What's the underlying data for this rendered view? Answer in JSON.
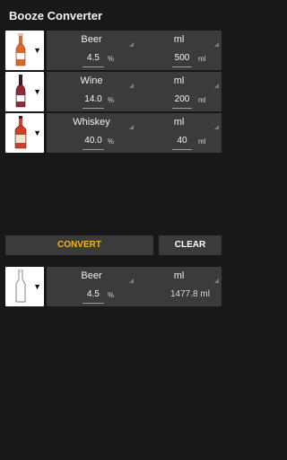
{
  "app": {
    "title": "Booze Converter"
  },
  "rows": [
    {
      "drink": "Beer",
      "unit": "ml",
      "percent": "4.5",
      "percent_suffix": "%",
      "amount": "500",
      "amount_suffix": "ml",
      "bottle_color": "#d9692f"
    },
    {
      "drink": "Wine",
      "unit": "ml",
      "percent": "14.0",
      "percent_suffix": "%",
      "amount": "200",
      "amount_suffix": "ml",
      "bottle_color": "#8e2a3a"
    },
    {
      "drink": "Whiskey",
      "unit": "ml",
      "percent": "40.0",
      "percent_suffix": "%",
      "amount": "40",
      "amount_suffix": "ml",
      "bottle_color": "#c9422a"
    }
  ],
  "actions": {
    "convert_label": "CONVERT",
    "clear_label": "CLEAR",
    "convert_color": "#f4b41a"
  },
  "result": {
    "drink": "Beer",
    "unit": "ml",
    "percent": "4.5",
    "percent_suffix": "%",
    "amount": "1477.8 ml"
  },
  "icons": {
    "dropdown": "caret-down-icon",
    "bottle": "bottle-icon"
  }
}
